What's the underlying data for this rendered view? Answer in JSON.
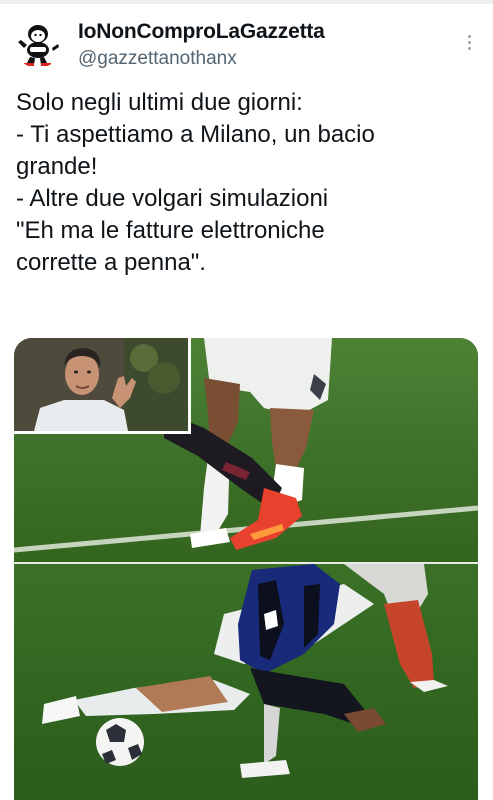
{
  "account": {
    "display_name": "IoNonComproLaGazzetta",
    "handle": "@gazzettanothanx",
    "avatar_icon": "cartoon-mascot-icon"
  },
  "tweet": {
    "lines": [
      "Solo negli ultimi due giorni:",
      "- Ti aspettiamo a Milano, un bacio",
      "grande!",
      "- Altre due volgari simulazioni",
      "\"Eh ma le fatture elettroniche",
      "corrette a penna\"."
    ]
  },
  "colors": {
    "text": "#0f1419",
    "secondary_text": "#536471",
    "pitch_green": "#3d7028"
  }
}
